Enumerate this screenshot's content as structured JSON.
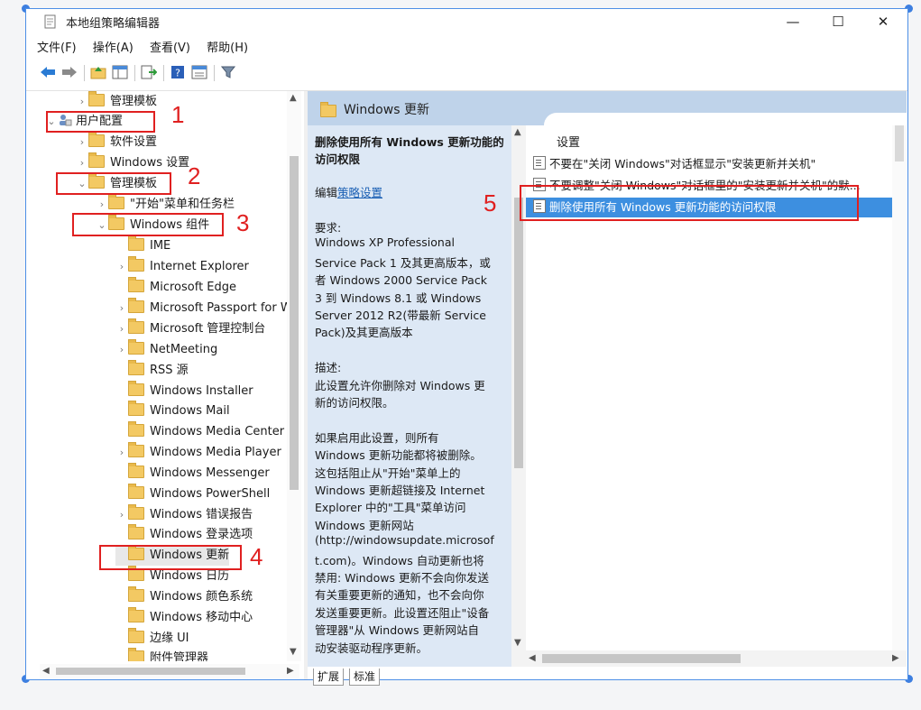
{
  "window": {
    "title": "本地组策略编辑器",
    "minimize": "—",
    "maximize": "☐",
    "close": "✕"
  },
  "menu": [
    "文件(F)",
    "操作(A)",
    "查看(V)",
    "帮助(H)"
  ],
  "toolbar": [
    "back-icon",
    "forward-icon",
    "up-folder-icon",
    "show-hide-tree-icon",
    "export-list-icon",
    "help-icon",
    "properties-icon",
    "filter-icon"
  ],
  "tree": [
    {
      "label": "管理模板",
      "expander": "›",
      "folder": true
    },
    {
      "label": "用户配置",
      "expander": "⌄",
      "folder": false
    },
    {
      "label": "软件设置",
      "expander": "›",
      "folder": true
    },
    {
      "label": "Windows 设置",
      "expander": "›",
      "folder": true
    },
    {
      "label": "管理模板",
      "expander": "⌄",
      "folder": true
    },
    {
      "label": "\"开始\"菜单和任务栏",
      "expander": "›",
      "folder": true
    },
    {
      "label": "Windows 组件",
      "expander": "⌄",
      "folder": true
    },
    {
      "label": "IME",
      "expander": "",
      "folder": true
    },
    {
      "label": "Internet Explorer",
      "expander": "›",
      "folder": true
    },
    {
      "label": "Microsoft Edge",
      "expander": "",
      "folder": true
    },
    {
      "label": "Microsoft Passport for W",
      "expander": "›",
      "folder": true
    },
    {
      "label": "Microsoft 管理控制台",
      "expander": "›",
      "folder": true
    },
    {
      "label": "NetMeeting",
      "expander": "›",
      "folder": true
    },
    {
      "label": "RSS 源",
      "expander": "",
      "folder": true
    },
    {
      "label": "Windows Installer",
      "expander": "",
      "folder": true
    },
    {
      "label": "Windows Mail",
      "expander": "",
      "folder": true
    },
    {
      "label": "Windows Media Center",
      "expander": "",
      "folder": true
    },
    {
      "label": "Windows Media Player",
      "expander": "›",
      "folder": true
    },
    {
      "label": "Windows Messenger",
      "expander": "",
      "folder": true
    },
    {
      "label": "Windows PowerShell",
      "expander": "",
      "folder": true
    },
    {
      "label": "Windows 错误报告",
      "expander": "›",
      "folder": true
    },
    {
      "label": "Windows 登录选项",
      "expander": "",
      "folder": true
    },
    {
      "label": "Windows 更新",
      "expander": "",
      "folder": true
    },
    {
      "label": "Windows 日历",
      "expander": "",
      "folder": true
    },
    {
      "label": "Windows 颜色系统",
      "expander": "",
      "folder": true
    },
    {
      "label": "Windows 移动中心",
      "expander": "",
      "folder": true
    },
    {
      "label": "边缘 UI",
      "expander": "",
      "folder": true
    },
    {
      "label": "附件管理器",
      "expander": "",
      "folder": true
    }
  ],
  "right_header": "Windows 更新",
  "description": {
    "title": "删除使用所有 Windows 更新功能的访问权限",
    "edit_prefix": "编辑",
    "edit_link": "策略设置",
    "lines": [
      "要求:",
      "Windows XP Professional",
      "Service Pack 1 及其更高版本，或",
      "者 Windows 2000 Service Pack",
      "3 到 Windows 8.1 或 Windows",
      "Server 2012 R2(带最新 Service",
      "Pack)及其更高版本",
      "",
      "描述:",
      "此设置允许你删除对 Windows 更",
      "新的访问权限。",
      "",
      "如果启用此设置，则所有",
      "Windows 更新功能都将被删除。",
      "这包括阻止从\"开始\"菜单上的",
      "Windows 更新超链接及 Internet",
      "Explorer 中的\"工具\"菜单访问",
      "Windows 更新网站",
      "(http://windowsupdate.microsof",
      "t.com)。Windows 自动更新也将",
      "禁用: Windows 更新不会向你发送",
      "有关重要更新的通知，也不会向你",
      "发送重要更新。此设置还阻止\"设备",
      "管理器\"从 Windows 更新网站自",
      "动安装驱动程序更新。"
    ]
  },
  "list_header": "设置",
  "policies": [
    "不要在\"关闭 Windows\"对话框显示\"安装更新并关机\"",
    "不要调整\"关闭 Windows\"对话框里的\"安装更新并关机\"的默...",
    "删除使用所有 Windows 更新功能的访问权限"
  ],
  "tabs": [
    "扩展",
    "标准"
  ],
  "annotations": [
    "1",
    "2",
    "3",
    "4",
    "5"
  ],
  "colors": {
    "selected_row": "#3d8fe0",
    "annotation": "#e02020",
    "header_band": "#bfd3ea",
    "desc_bg": "#dde8f5"
  }
}
